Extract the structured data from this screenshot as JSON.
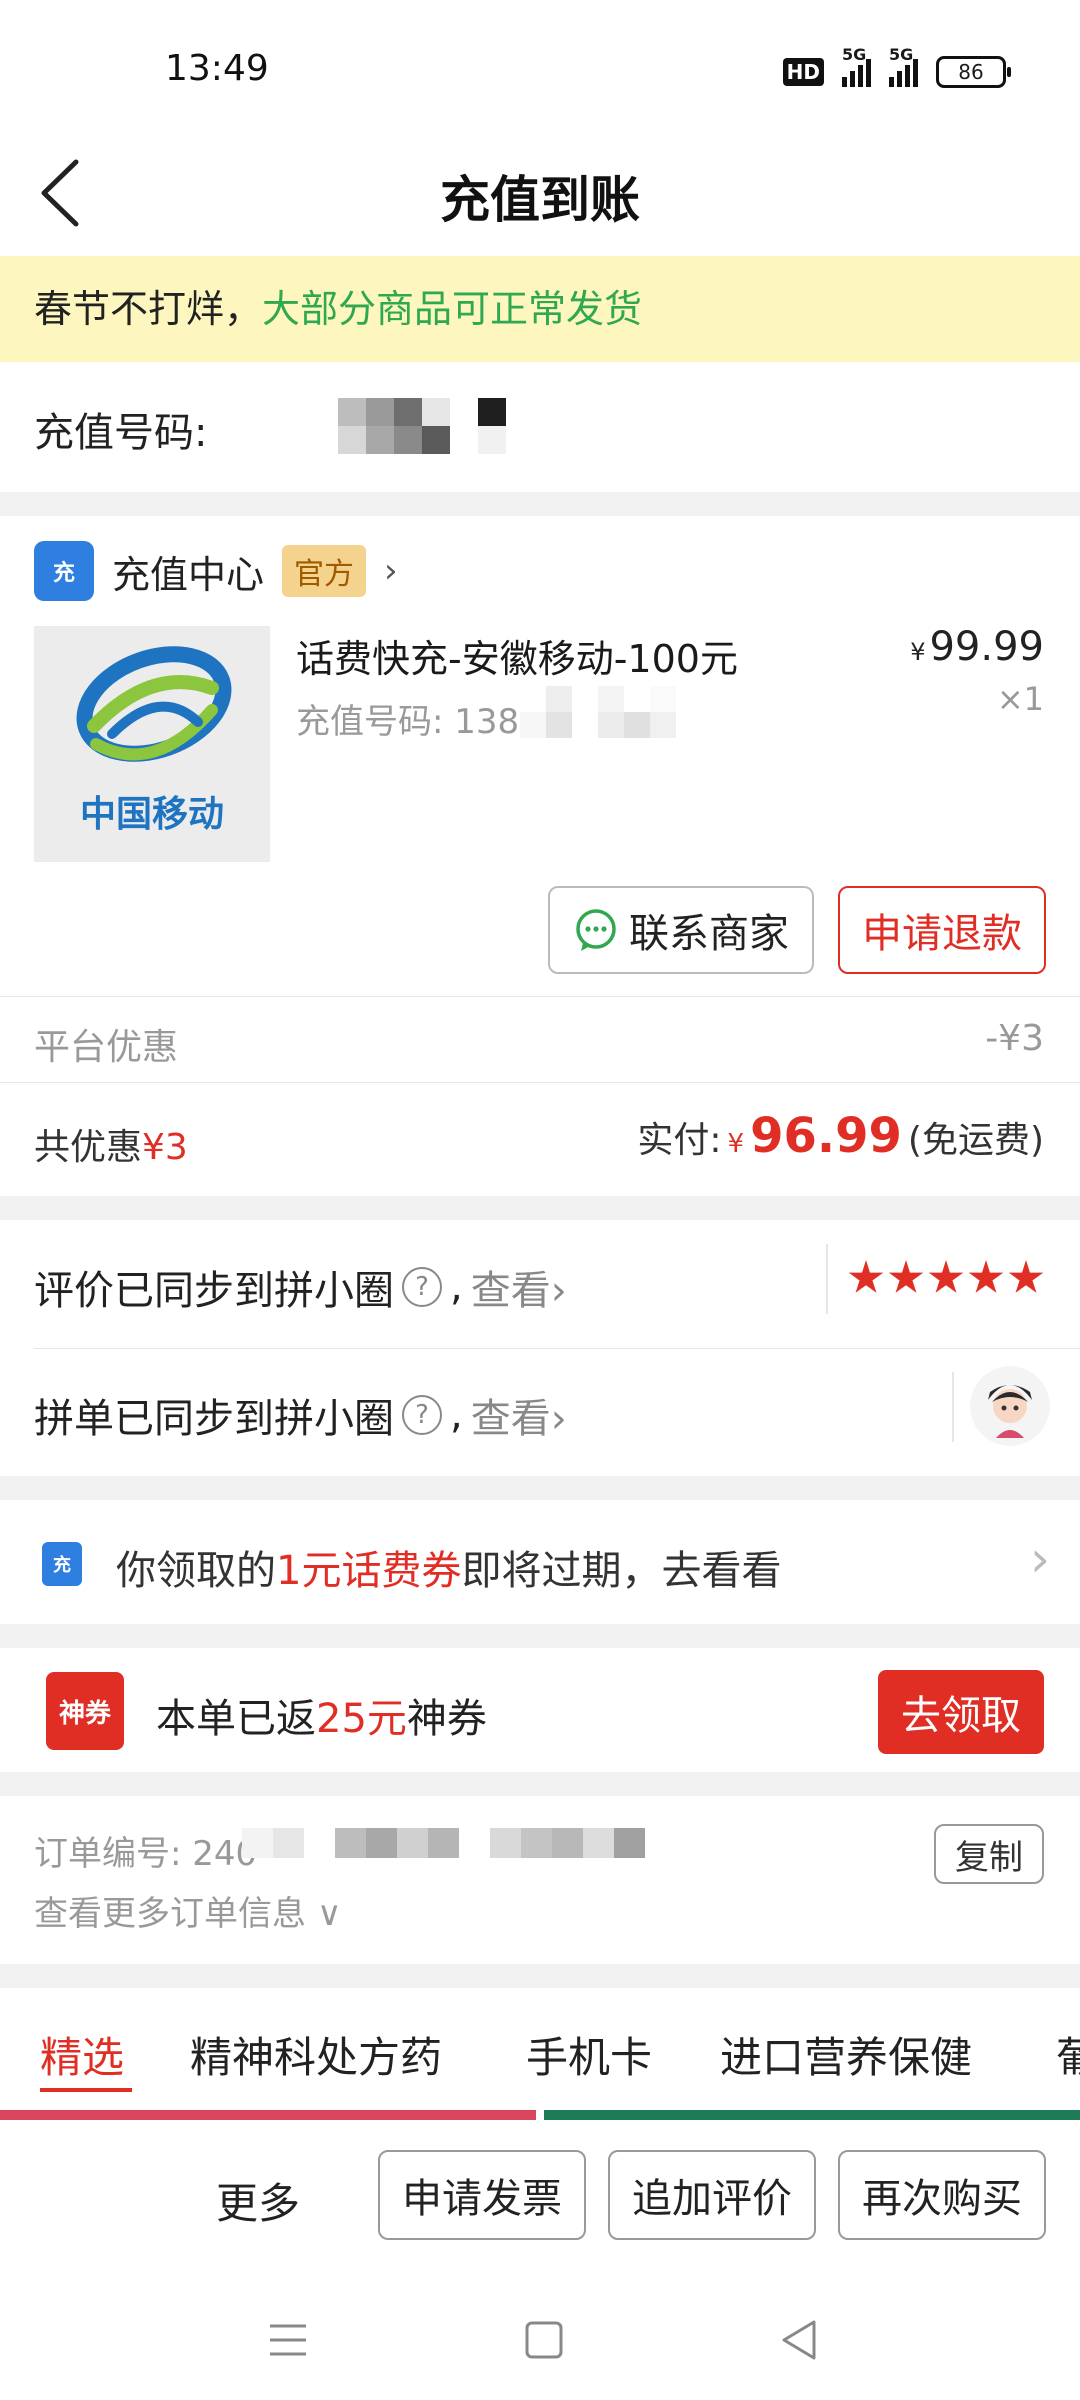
{
  "status_bar": {
    "time": "13:49",
    "hd_label": "HD",
    "signal_1_label": "5G",
    "signal_2_label": "5G",
    "battery": "86"
  },
  "header": {
    "title": "充值到账"
  },
  "notice": {
    "prefix": "春节不打烊，",
    "highlight": "大部分商品可正常发货",
    "highlight_color": "#2fa84f"
  },
  "recharge_number": {
    "label": "充值号码:"
  },
  "shop": {
    "icon_text": "充",
    "name": "充值中心",
    "badge": "官方"
  },
  "product": {
    "logo_text": "中国移动",
    "title": "话费快充-安徽移动-100元",
    "sub_label": "充值号码: 138",
    "price_symbol": "¥",
    "price": "99.99",
    "quantity": "×1"
  },
  "actions": {
    "contact": "联系商家",
    "refund": "申请退款"
  },
  "discount": {
    "label": "平台优惠",
    "value": "-¥3"
  },
  "totals": {
    "saved_label": "共优惠",
    "saved_value": "¥3",
    "paid_label": "实付:",
    "currency": "¥",
    "paid_amount": "96.99",
    "shipping_note": "(免运费)"
  },
  "social": {
    "review_text": "评价已同步到拼小圈",
    "group_text": "拼单已同步到拼小圈",
    "help_glyph": "?",
    "separator": ",",
    "view_link": "查看",
    "rating_stars": 5
  },
  "coupon": {
    "icon_text": "充",
    "prefix": "你领取的",
    "highlight": "1元话费券",
    "suffix": "即将过期，去看看"
  },
  "bonus": {
    "icon_text": "神券",
    "prefix": "本单已返",
    "highlight": "25元",
    "suffix": "神券",
    "button": "去领取"
  },
  "order": {
    "number_label": "订单编号: 240",
    "copy_button": "复制",
    "more_info": "查看更多订单信息"
  },
  "tabs": [
    {
      "label": "精选"
    },
    {
      "label": "精神科处方药"
    },
    {
      "label": "手机卡"
    },
    {
      "label": "进口营养保健"
    },
    {
      "label": "葡"
    }
  ],
  "bottom_bar": {
    "more": "更多",
    "invoice": "申请发票",
    "add_review": "追加评价",
    "buy_again": "再次购买"
  },
  "colors": {
    "accent_red": "#e02e24",
    "notice_bg": "#fdf6bf",
    "official_badge_bg": "#f4d38f"
  }
}
